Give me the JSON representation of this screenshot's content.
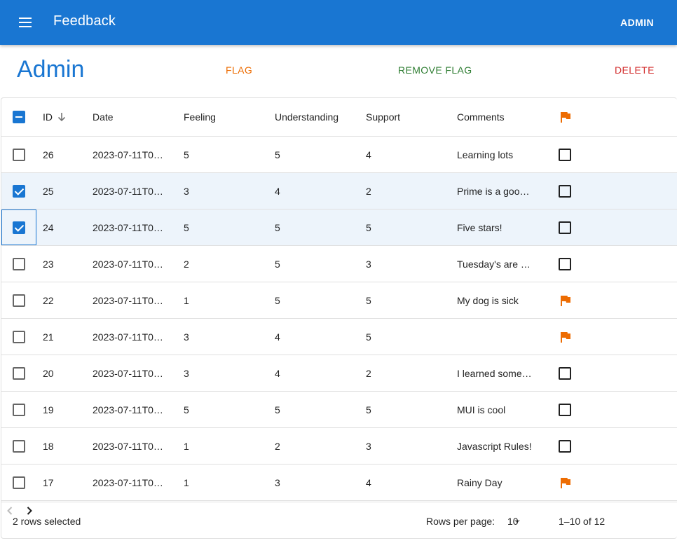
{
  "header": {
    "title": "Feedback",
    "admin_link": "ADMIN"
  },
  "page": {
    "heading": "Admin"
  },
  "actions": {
    "flag": "FLAG",
    "remove_flag": "REMOVE FLAG",
    "delete": "DELETE"
  },
  "table": {
    "columns": {
      "id": "ID",
      "date": "Date",
      "feeling": "Feeling",
      "understanding": "Understanding",
      "support": "Support",
      "comments": "Comments"
    },
    "rows": [
      {
        "id": "26",
        "date": "2023-07-11T0…",
        "feeling": "5",
        "understanding": "5",
        "support": "4",
        "comments": "Learning lots",
        "flagged": false,
        "selected": false
      },
      {
        "id": "25",
        "date": "2023-07-11T0…",
        "feeling": "3",
        "understanding": "4",
        "support": "2",
        "comments": "Prime is a goo…",
        "flagged": false,
        "selected": true
      },
      {
        "id": "24",
        "date": "2023-07-11T0…",
        "feeling": "5",
        "understanding": "5",
        "support": "5",
        "comments": "Five stars!",
        "flagged": false,
        "selected": true
      },
      {
        "id": "23",
        "date": "2023-07-11T0…",
        "feeling": "2",
        "understanding": "5",
        "support": "3",
        "comments": "Tuesday's are …",
        "flagged": false,
        "selected": false
      },
      {
        "id": "22",
        "date": "2023-07-11T0…",
        "feeling": "1",
        "understanding": "5",
        "support": "5",
        "comments": "My dog is sick",
        "flagged": true,
        "selected": false
      },
      {
        "id": "21",
        "date": "2023-07-11T0…",
        "feeling": "3",
        "understanding": "4",
        "support": "5",
        "comments": "",
        "flagged": true,
        "selected": false
      },
      {
        "id": "20",
        "date": "2023-07-11T0…",
        "feeling": "3",
        "understanding": "4",
        "support": "2",
        "comments": "I learned some…",
        "flagged": false,
        "selected": false
      },
      {
        "id": "19",
        "date": "2023-07-11T0…",
        "feeling": "5",
        "understanding": "5",
        "support": "5",
        "comments": "MUI is cool",
        "flagged": false,
        "selected": false
      },
      {
        "id": "18",
        "date": "2023-07-11T0…",
        "feeling": "1",
        "understanding": "2",
        "support": "3",
        "comments": "Javascript Rules!",
        "flagged": false,
        "selected": false
      },
      {
        "id": "17",
        "date": "2023-07-11T0…",
        "feeling": "1",
        "understanding": "3",
        "support": "4",
        "comments": "Rainy Day",
        "flagged": true,
        "selected": false
      }
    ]
  },
  "footer": {
    "selected_text": "2 rows selected",
    "rows_per_page_label": "Rows per page:",
    "rows_per_page_value": "10",
    "range": "1–10 of 12"
  },
  "colors": {
    "primary": "#1976d2",
    "flag": "#ed6c02",
    "remove": "#2e7d32",
    "delete": "#d32f2f"
  },
  "icons": {
    "menu": "menu-icon",
    "sort": "arrow-down-icon",
    "flag": "flag-icon",
    "select": "dropdown-icon",
    "prev": "chevron-left-icon",
    "next": "chevron-right-icon"
  }
}
